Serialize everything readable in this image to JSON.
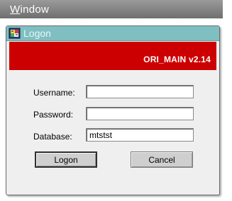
{
  "menu": {
    "window_mnemonic": "W",
    "window_rest": "indow"
  },
  "dialog": {
    "title": "Logon",
    "app_icon": "oracle-forms-icon",
    "banner_text": "ORI_MAIN v2.14"
  },
  "form": {
    "username_label": "Username:",
    "username_value": "",
    "password_label": "Password:",
    "password_value": "",
    "database_label": "Database:",
    "database_value": "mtstst"
  },
  "buttons": {
    "logon": "Logon",
    "cancel": "Cancel"
  },
  "colors": {
    "titlebar": "#7fbfc2",
    "banner": "#cc0000",
    "menubar": "#8a8a8a"
  }
}
